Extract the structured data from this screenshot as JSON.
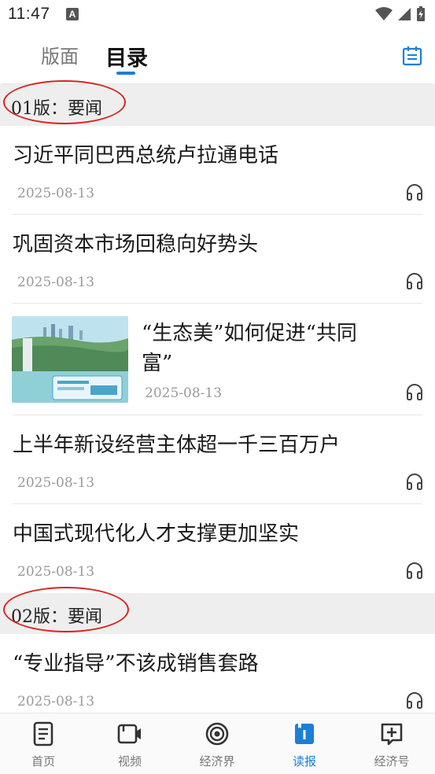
{
  "status_bar": {
    "time": "11:47",
    "notification_badge": "A"
  },
  "top_tabs": {
    "layout_label": "版面",
    "toc_label": "目录",
    "active": "目录"
  },
  "sections": [
    {
      "title": "01版：要闻"
    },
    {
      "title": "02版：要闻"
    }
  ],
  "articles": [
    {
      "title": "习近平同巴西总统卢拉通电话",
      "date": "2025-08-13"
    },
    {
      "title": "巩固资本市场回稳向好势头",
      "date": "2025-08-13"
    },
    {
      "title_line1": "“生态美”如何促进“共同",
      "title_line2": "富”",
      "date": "2025-08-13",
      "has_thumbnail": true
    },
    {
      "title": "上半年新设经营主体超一千三百万户",
      "date": "2025-08-13"
    },
    {
      "title": "中国式现代化人才支撑更加坚实",
      "date": "2025-08-13"
    },
    {
      "title": "“专业指导”不该成销售套路",
      "date": "2025-08-13"
    }
  ],
  "bottom_nav": [
    {
      "label": "首页",
      "icon": "document-icon"
    },
    {
      "label": "视频",
      "icon": "video-icon"
    },
    {
      "label": "经济界",
      "icon": "target-icon"
    },
    {
      "label": "读报",
      "icon": "book-icon",
      "active": true
    },
    {
      "label": "经济号",
      "icon": "add-note-icon"
    }
  ],
  "colors": {
    "accent": "#1b7fd6",
    "annotation_red": "#d9241e",
    "section_bg": "#eeeeee"
  }
}
